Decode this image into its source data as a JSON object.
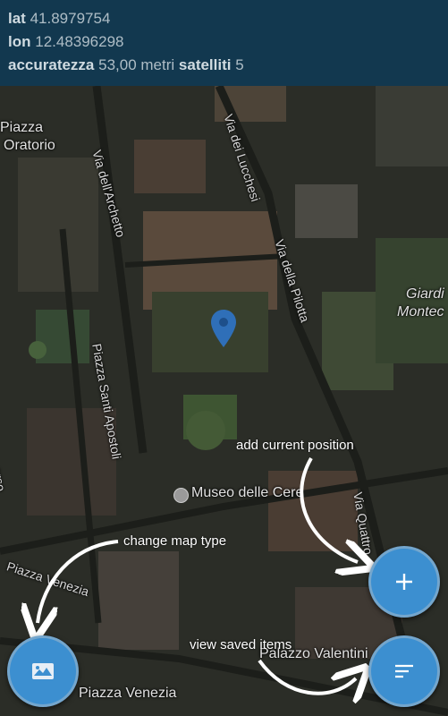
{
  "gps": {
    "lat_label": "lat",
    "lat_value": "41.8979754",
    "lon_label": "lon",
    "lon_value": "12.48396298",
    "accuracy_label": "accuratezza",
    "accuracy_value": "53,00 metri",
    "satellites_label": "satelliti",
    "satellites_value": "5"
  },
  "map": {
    "streets": [
      "Piazza",
      "Oratorio",
      "Via dell'Archetto",
      "Via dei Lucchesi",
      "Via della Pilotta",
      "Piazza Santi Apostoli",
      "Via Quattro",
      "Giardi",
      "Montec",
      "orso",
      "Piazza Venezia",
      "Piazza Venezia",
      "Palazzo Valentini"
    ],
    "poi": "Museo delle Cere"
  },
  "hints": {
    "add_position": "add current position",
    "change_map_type": "change map type",
    "view_saved": "view saved items"
  },
  "colors": {
    "header_bg": "#12384f",
    "fab": "#3c8fd0",
    "pin": "#2f6fb8"
  },
  "icons": {
    "add": "plus-icon",
    "map_type": "map-icon",
    "saved": "list-icon",
    "location": "location-pin-icon"
  }
}
